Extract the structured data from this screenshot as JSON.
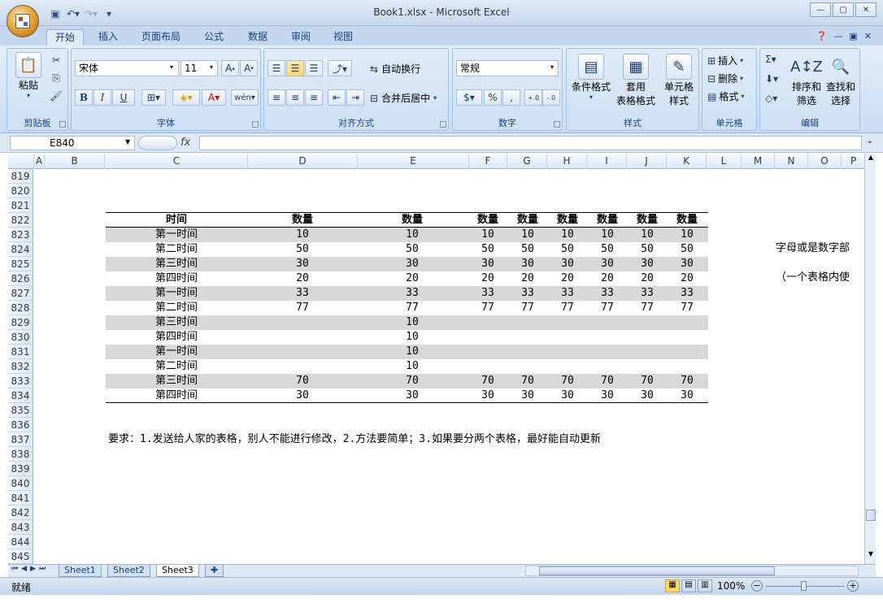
{
  "window": {
    "title": "Book1.xlsx - Microsoft Excel"
  },
  "ribbon": {
    "tabs": [
      "开始",
      "插入",
      "页面布局",
      "公式",
      "数据",
      "审阅",
      "视图"
    ],
    "clipboard": {
      "paste": "粘贴",
      "group": "剪贴板"
    },
    "font": {
      "name": "宋体",
      "size": "11",
      "group": "字体",
      "bold": "B",
      "italic": "I",
      "underline": "U"
    },
    "alignment": {
      "wrap": "自动换行",
      "merge": "合并后居中",
      "group": "对齐方式"
    },
    "number": {
      "format": "常规",
      "group": "数字",
      "percent": "%",
      "comma": ","
    },
    "styles": {
      "cond": "条件格式",
      "table1": "套用",
      "table2": "表格格式",
      "cell1": "单元格",
      "cell2": "样式",
      "group": "样式"
    },
    "cells": {
      "insert": "插入",
      "delete": "删除",
      "format": "格式",
      "group": "单元格"
    },
    "editing": {
      "sort1": "排序和",
      "sort2": "筛选",
      "find1": "查找和",
      "find2": "选择",
      "group": "编辑"
    }
  },
  "formula_bar": {
    "name_box": "E840",
    "fx": "fx",
    "value": ""
  },
  "columns": [
    "A",
    "B",
    "C",
    "D",
    "E",
    "F",
    "G",
    "H",
    "I",
    "J",
    "K",
    "L",
    "M",
    "N",
    "O",
    "P"
  ],
  "rows": [
    "819",
    "820",
    "821",
    "822",
    "823",
    "824",
    "825",
    "826",
    "827",
    "828",
    "829",
    "830",
    "831",
    "832",
    "833",
    "834",
    "835",
    "836",
    "837",
    "838",
    "839",
    "840",
    "841",
    "842",
    "843",
    "844",
    "845"
  ],
  "table": {
    "header": [
      "时间",
      "数量",
      "数量",
      "数量",
      "数量",
      "数量",
      "数量",
      "数量",
      "数量"
    ],
    "rows": [
      [
        "第一时间",
        "10",
        "10",
        "10",
        "10",
        "10",
        "10",
        "10",
        "10"
      ],
      [
        "第二时间",
        "50",
        "50",
        "50",
        "50",
        "50",
        "50",
        "50",
        "50"
      ],
      [
        "第三时间",
        "30",
        "30",
        "30",
        "30",
        "30",
        "30",
        "30",
        "30"
      ],
      [
        "第四时间",
        "20",
        "20",
        "20",
        "20",
        "20",
        "20",
        "20",
        "20"
      ],
      [
        "第一时间",
        "33",
        "33",
        "33",
        "33",
        "33",
        "33",
        "33",
        "33"
      ],
      [
        "第二时间",
        "77",
        "77",
        "77",
        "77",
        "77",
        "77",
        "77",
        "77"
      ],
      [
        "第三时间",
        "",
        "10",
        "",
        "",
        "",
        "",
        "",
        ""
      ],
      [
        "第四时间",
        "",
        "10",
        "",
        "",
        "",
        "",
        "",
        ""
      ],
      [
        "第一时间",
        "",
        "10",
        "",
        "",
        "",
        "",
        "",
        ""
      ],
      [
        "第二时间",
        "",
        "10",
        "",
        "",
        "",
        "",
        "",
        ""
      ],
      [
        "第三时间",
        "70",
        "70",
        "70",
        "70",
        "70",
        "70",
        "70",
        "70"
      ],
      [
        "第四时间",
        "30",
        "30",
        "30",
        "30",
        "30",
        "30",
        "30",
        "30"
      ]
    ]
  },
  "side_text": {
    "line1": "字母或是数字部",
    "line2": "（一个表格内使"
  },
  "note": "要求：1.发送给人家的表格，别人不能进行修改，2.方法要简单；3.如果要分两个表格，最好能自动更新",
  "sheets": [
    "Sheet1",
    "Sheet2",
    "Sheet3"
  ],
  "status": {
    "ready": "就绪",
    "zoom": "100%"
  }
}
